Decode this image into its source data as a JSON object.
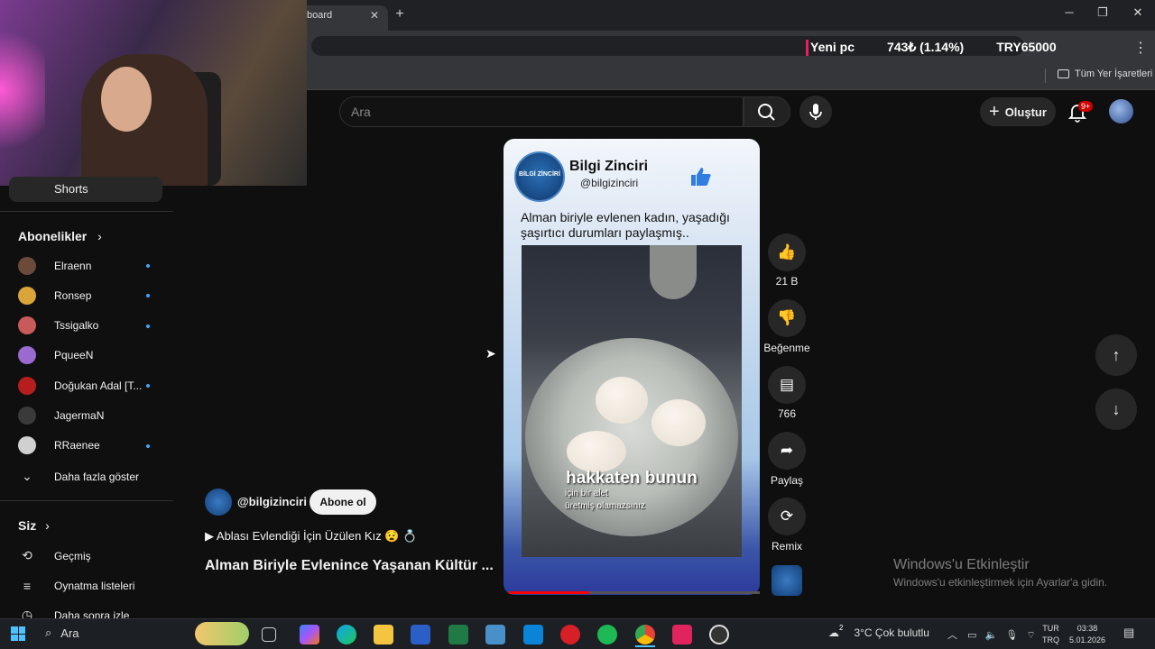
{
  "browser": {
    "tab_title": "board",
    "tab_close": "✕",
    "new_tab": "+",
    "win_minimize": "─",
    "win_maximize": "❐",
    "win_close": "✕",
    "ticker": [
      "Yeni pc",
      "743₺ (1.14%)",
      "TRY65000"
    ],
    "bookmarks_all": "Tüm Yer İşaretleri"
  },
  "header": {
    "search_placeholder": "Ara",
    "create_label": "Oluştur",
    "notif_badge": "9+"
  },
  "sidebar": {
    "shorts_label": "Shorts",
    "subscriptions_heading": "Abonelikler",
    "subscriptions": [
      {
        "name": "Elraenn",
        "color": "#6b4a3a",
        "new": true
      },
      {
        "name": "Ronsep",
        "color": "#d9a53a",
        "new": true
      },
      {
        "name": "Tssigalko",
        "color": "#c85a5a",
        "new": true
      },
      {
        "name": "PqueeN",
        "color": "#9a6ad0",
        "new": false
      },
      {
        "name": "Doğukan Adal [T...",
        "color": "#b81d1d",
        "new": true
      },
      {
        "name": "JagermaN",
        "color": "#3a3a3a",
        "new": false
      },
      {
        "name": "RRaenee",
        "color": "#d0d0d0",
        "new": true
      }
    ],
    "show_more": "Daha fazla göster",
    "you_heading": "Siz",
    "you_items": [
      "Geçmiş",
      "Oynatma listeleri",
      "Daha sonra izle"
    ]
  },
  "short": {
    "channel_name": "Bilgi Zinciri",
    "channel_handle": "@bilgizinciri",
    "logo_text": "BİLGİ ZİNCİRİ",
    "caption": "Alman biriyle evlenen kadın, yaşadığı şaşırtıcı durumları paylaşmış..",
    "overlay_big": "hakkaten bunun",
    "overlay_line1": "için bir alet",
    "overlay_line2": "üretmiş olamazsınız",
    "progress": 0.32
  },
  "actions": {
    "like_count": "21 B",
    "dislike_label": "Beğenme",
    "comment_count": "766",
    "share_label": "Paylaş",
    "remix_label": "Remix"
  },
  "meta": {
    "handle": "@bilgizinciri",
    "subscribe_label": "Abone ol",
    "playlist_line": "▶ Ablası Evlendiği İçin Üzülen Kız 😧 💍",
    "title": "Alman Biriyle Evlenince Yaşanan Kültür ..."
  },
  "watermark": {
    "line1": "Windows'u Etkinleştir",
    "line2": "Windows'u etkinleştirmek için Ayarlar'a gidin."
  },
  "taskbar": {
    "search_label": "Ara",
    "weather": "3°C  Çok bulutlu",
    "weather_badge": "2",
    "lang_top": "TUR",
    "lang_bottom": "TRQ",
    "time": "03:38",
    "date": "5.01.2026"
  }
}
